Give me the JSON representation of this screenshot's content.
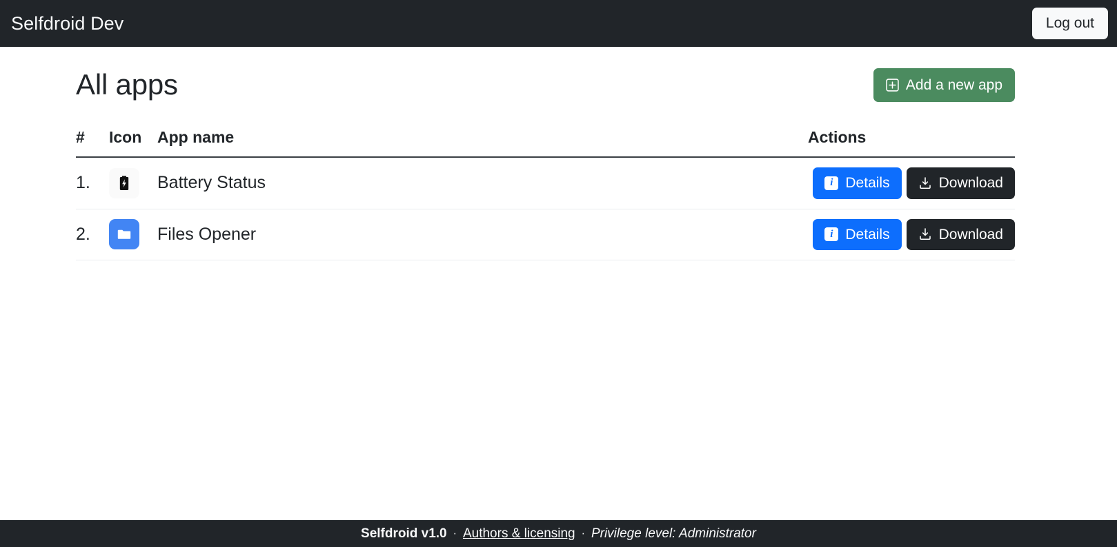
{
  "navbar": {
    "brand": "Selfdroid Dev",
    "logout_label": "Log out"
  },
  "main": {
    "page_title": "All apps",
    "add_app_label": "Add a new app",
    "add_app_icon": "plus-square-icon",
    "add_app_color": "#4b8b5f",
    "table": {
      "headers": {
        "num": "#",
        "icon": "Icon",
        "name": "App name",
        "actions": "Actions"
      },
      "rows": [
        {
          "num": "1.",
          "icon": "battery-charging-icon",
          "icon_bg": "#fafafa",
          "name": "Battery Status",
          "details_label": "Details",
          "details_icon": "info-icon",
          "download_label": "Download",
          "download_icon": "download-icon"
        },
        {
          "num": "2.",
          "icon": "folder-icon",
          "icon_bg": "#4285f4",
          "name": "Files Opener",
          "details_label": "Details",
          "details_icon": "info-icon",
          "download_label": "Download",
          "download_icon": "download-icon"
        }
      ]
    }
  },
  "footer": {
    "version": "Selfdroid v1.0",
    "sep1": "·",
    "authors_link": "Authors & licensing",
    "sep2": "·",
    "privilege": "Privilege level: Administrator"
  },
  "colors": {
    "dark_bar": "#212529",
    "primary_blue": "#0d6efd",
    "green": "#4b8b5f",
    "folder_blue": "#4285f4"
  }
}
